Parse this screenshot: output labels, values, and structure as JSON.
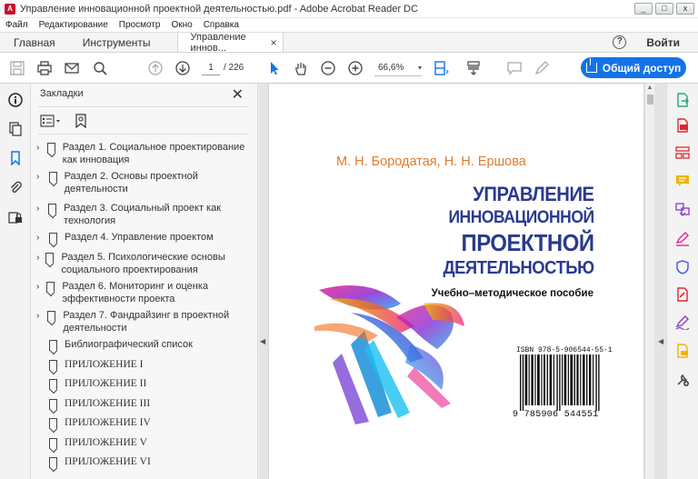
{
  "window": {
    "title": "Управление инновационной проектной деятельностью.pdf - Adobe Acrobat Reader DC",
    "controls": [
      "_",
      "□",
      "x"
    ]
  },
  "menu": [
    "Файл",
    "Редактирование",
    "Просмотр",
    "Окно",
    "Справка"
  ],
  "tabs": {
    "home": "Главная",
    "tools": "Инструменты",
    "doc": "Управление иннов...",
    "close": "×",
    "help": "?",
    "login": "Войти"
  },
  "toolbar": {
    "page_current": "1",
    "page_total": "/ 226",
    "zoom": "66,6%",
    "zoom_caret": "▾",
    "share": "Общий доступ"
  },
  "bookmarks": {
    "title": "Закладки",
    "close": "✕",
    "items": [
      {
        "label": "Раздел 1. Социальное проектирование как инновация",
        "expandable": true
      },
      {
        "label": "Раздел 2. Основы проектной деятельности",
        "expandable": true
      },
      {
        "label": "Раздел 3. Социальный проект как технология",
        "expandable": true
      },
      {
        "label": "Раздел 4. Управление проектом",
        "expandable": true
      },
      {
        "label": "Раздел 5. Психологические основы социального проектирования",
        "expandable": true
      },
      {
        "label": "Раздел 6. Мониторинг и оценка эффективности проекта",
        "expandable": true
      },
      {
        "label": "Раздел 7. Фандрайзинг  в проектной деятельности",
        "expandable": true
      },
      {
        "label": "Библиографический список",
        "expandable": false
      },
      {
        "label": "ПРИЛОЖЕНИЕ I",
        "expandable": false
      },
      {
        "label": "ПРИЛОЖЕНИЕ II",
        "expandable": false
      },
      {
        "label": "ПРИЛОЖЕНИЕ III",
        "expandable": false
      },
      {
        "label": "ПРИЛОЖЕНИЕ IV",
        "expandable": false
      },
      {
        "label": "ПРИЛОЖЕНИЕ V",
        "expandable": false
      },
      {
        "label": "ПРИЛОЖЕНИЕ VI",
        "expandable": false
      }
    ]
  },
  "cover": {
    "authors": "М. Н. Бородатая, Н. Н. Ершова",
    "title_lines": [
      "УПРАВЛЕНИЕ",
      "ИННОВАЦИОННОЙ",
      "ПРОЕКТНОЙ",
      "ДЕЯТЕЛЬНОСТЬЮ"
    ],
    "subtitle": "Учебно–методическое пособие",
    "isbn": "ISBN 978-5-906544-55-1",
    "barcode_number": "9 785906 544551"
  },
  "colors": {
    "accent": "#1473e6",
    "author_orange": "#e07a2f",
    "title_blue": "#2a3a8f",
    "tool_red": "#e0262f",
    "tool_green": "#2aa876",
    "tool_purple": "#8c3bc4",
    "tool_yellow": "#f0b400"
  }
}
